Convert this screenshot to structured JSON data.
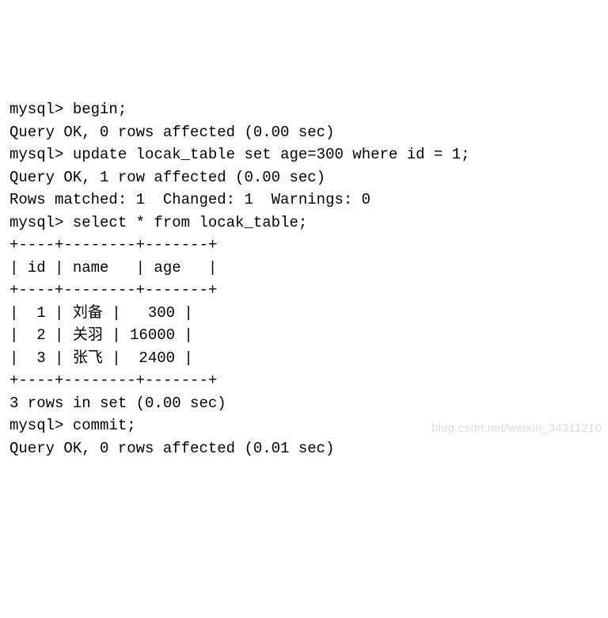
{
  "terminal": {
    "prompt": "mysql> ",
    "cmd_begin": "begin;",
    "resp_begin": "Query OK, 0 rows affected (0.00 sec)",
    "cmd_update": "update locak_table set age=300 where id = 1;",
    "resp_update_1": "Query OK, 1 row affected (0.00 sec)",
    "resp_update_2": "Rows matched: 1  Changed: 1  Warnings: 0",
    "cmd_select": "select * from locak_table;",
    "table_border": "+----+--------+-------+",
    "table_header": "| id | name   | age   |",
    "table_rows": [
      "|  1 | 刘备 |   300 |",
      "|  2 | 关羽 | 16000 |",
      "|  3 | 张飞 |  2400 |"
    ],
    "resp_select": "3 rows in set (0.00 sec)",
    "cmd_commit": "commit;",
    "resp_commit": "Query OK, 0 rows affected (0.01 sec)",
    "blank": ""
  },
  "watermark": "blog.csdn.net/weixin_34311210"
}
